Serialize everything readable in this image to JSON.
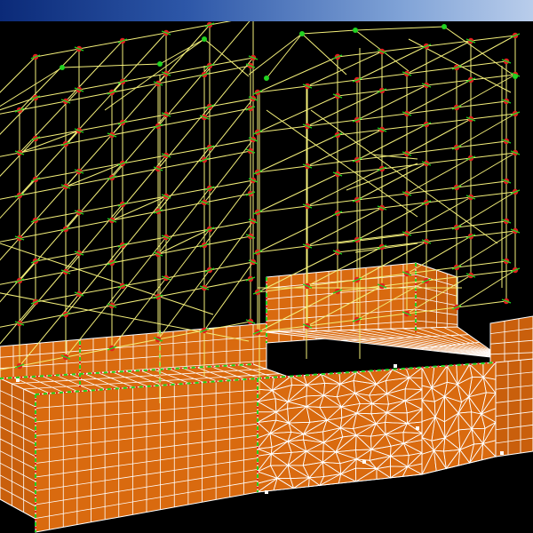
{
  "window": {
    "title": "",
    "status": ""
  },
  "viewport": {
    "background": "#000000",
    "wireframe_color": "#f4f07a",
    "node_color": "#e32020",
    "node_accent_color": "#21d321",
    "solid_fill_color": "#d96a0f",
    "solid_mesh_color": "#ffffff",
    "titlebar_gradient": [
      "#0b2a78",
      "#b9cdeb"
    ]
  }
}
